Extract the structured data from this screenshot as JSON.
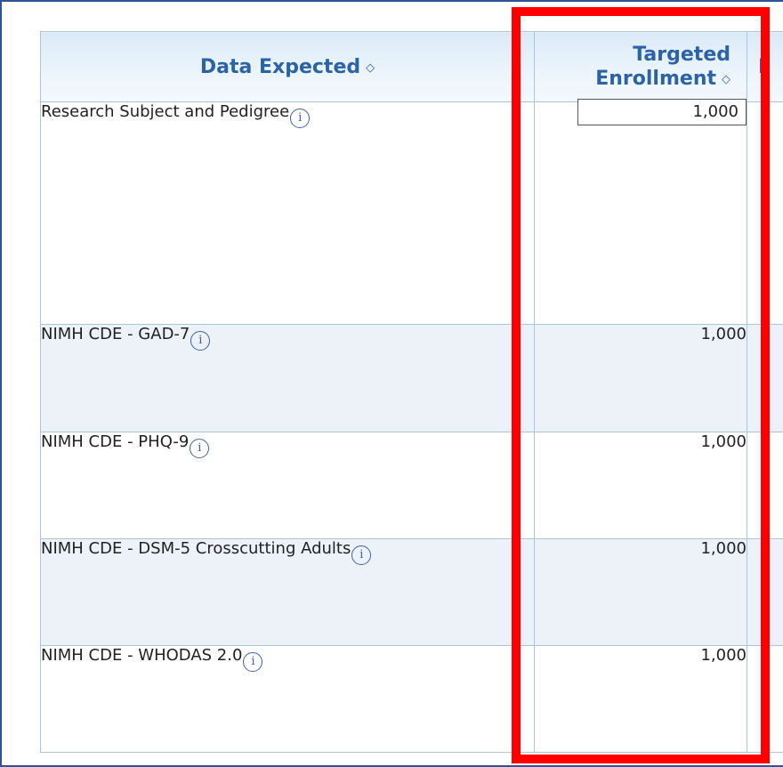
{
  "table": {
    "columns": [
      {
        "label": "Data Expected",
        "sort_icon": "sort-icon"
      },
      {
        "label_line1": "Targeted",
        "label_line2": "Enrollment",
        "sort_icon": "sort-icon"
      },
      {
        "label": "I"
      }
    ],
    "rows": [
      {
        "name": "Research Subject and Pedigree",
        "enrollment": "1,000",
        "editable": true
      },
      {
        "name": "NIMH CDE - GAD-7",
        "enrollment": "1,000"
      },
      {
        "name": "NIMH CDE - PHQ-9",
        "enrollment": "1,000"
      },
      {
        "name": "NIMH CDE - DSM-5 Crosscutting Adults",
        "enrollment": "1,000"
      },
      {
        "name": "NIMH CDE - WHODAS 2.0",
        "enrollment": "1,000"
      }
    ],
    "info_icon_glyph": "i",
    "sort_glyph": "⇕"
  },
  "colors": {
    "header_text": "#2c63a7",
    "border": "#a9c6e0",
    "row_alt": "#edf1f8",
    "highlight": "#ff0000",
    "frame": "#2c5597"
  }
}
